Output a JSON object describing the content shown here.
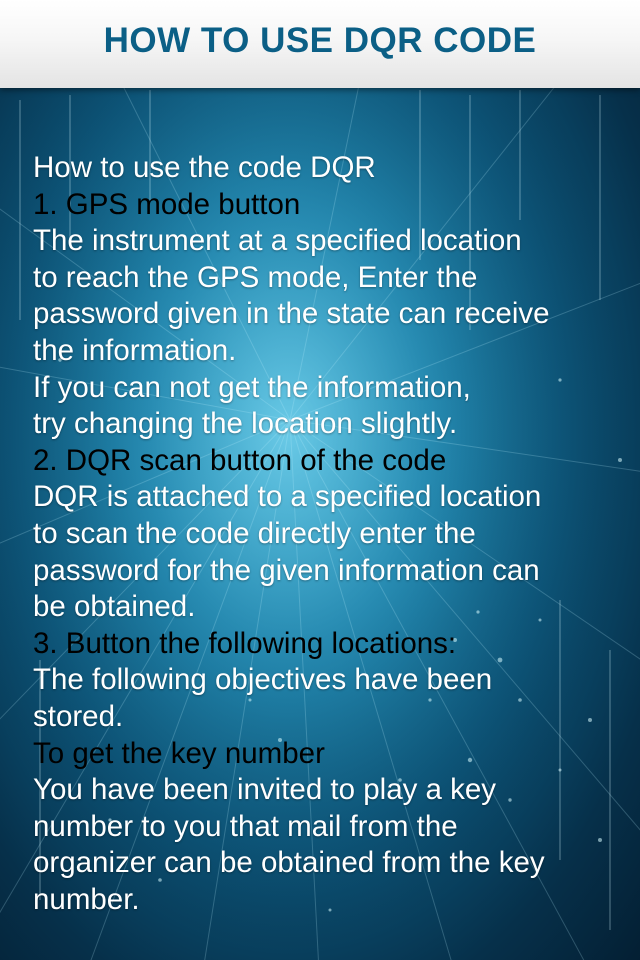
{
  "header": {
    "title": "HOW TO USE DQR CODE"
  },
  "content": {
    "lines": [
      "How to use the code DQR",
      "1. GPS mode button",
      "The instrument at a specified location",
      "to reach the GPS mode, Enter the",
      "password given in the state can receive",
      "the information.",
      "If you can not get the information,",
      "try changing the location slightly.",
      "2. DQR scan button of the code",
      "DQR is attached to a specified location",
      "to scan the code directly enter the",
      "password for the given information can",
      "be obtained.",
      "3. Button the following locations:",
      "The following objectives have been",
      "stored.",
      "To get the key number",
      "You have been invited to play a key",
      "number to you that mail from the",
      "organizer can be obtained from the key",
      "number."
    ]
  },
  "colors": {
    "header_text": "#0b5f86",
    "heading_text": "#000000",
    "body_text": "#ffffff",
    "background_center": "#3fb3d3",
    "background_edge": "#041f33"
  }
}
